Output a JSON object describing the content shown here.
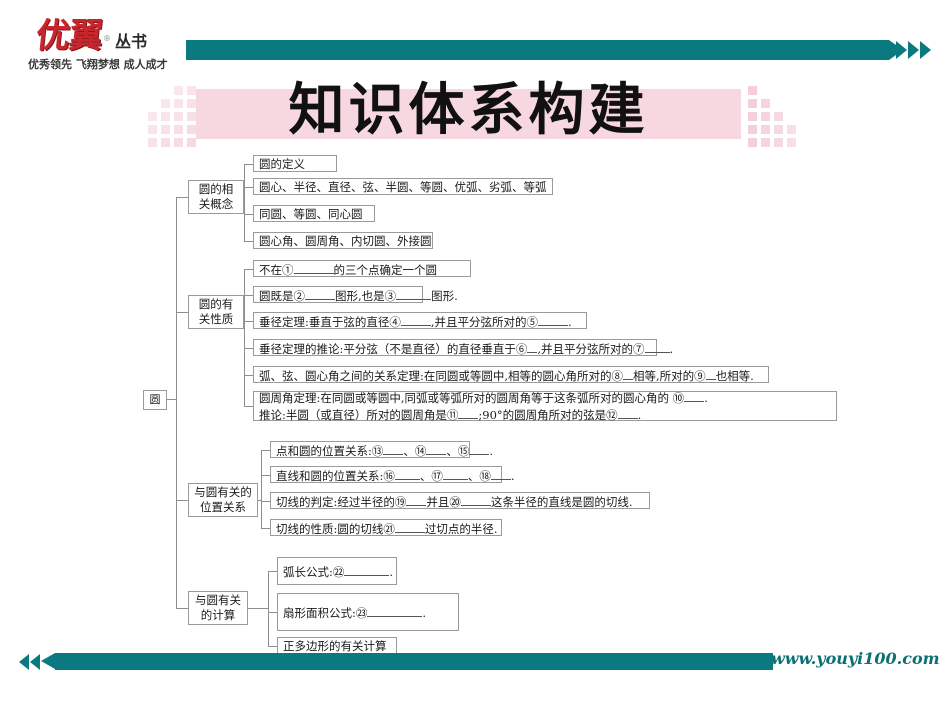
{
  "brand": {
    "logo_main": "优翼",
    "logo_reg": "®",
    "logo_series": "丛书",
    "slogan": "优秀领先 飞翔梦想 成人成才",
    "accent_teal": "#0b7a80",
    "accent_red": "#c9252c",
    "title_band_pink": "#f7d8e0"
  },
  "title": "知识体系构建",
  "footer": {
    "url": "www.youyi100.com"
  },
  "map": {
    "root": "圆",
    "branches": [
      {
        "label": "圆的相\n关概念",
        "label_lines": [
          "圆的相",
          "关概念"
        ],
        "items": [
          {
            "text": "圆的定义"
          },
          {
            "text": "圆心、半径、直径、弦、半圆、等圆、优弧、劣弧、等弧"
          },
          {
            "text": "同圆、等圆、同心圆"
          },
          {
            "text": "圆心角、圆周角、内切圆、外接圆"
          }
        ]
      },
      {
        "label_lines": [
          "圆的有",
          "关性质"
        ],
        "items": [
          {
            "text": "不在①________的三个点确定一个圆"
          },
          {
            "text": "圆既是②______图形,也是③_______图形."
          },
          {
            "text": "垂径定理:垂直于弦的直径④______,并且平分弦所对的⑤______."
          },
          {
            "text": "垂径定理的推论:平分弦（不是直径）的直径垂直于⑥__,并且平分弦所对的⑦_____."
          },
          {
            "text": "弧、弦、圆心角之间的关系定理:在同圆或等圆中,相等的圆心角所对的⑧__相等,所对的⑨__也相等."
          },
          {
            "lines": [
              "圆周角定理:在同圆或等圆中,同弧或等弧所对的圆周角等于这条弧所对的圆心角的 ⑩____.",
              "推论:半圆（或直径）所对的圆周角是⑪____;90°的圆周角所对的弦是⑫____."
            ]
          }
        ]
      },
      {
        "label_lines": [
          "与圆有关的",
          "位置关系"
        ],
        "items": [
          {
            "text": "点和圆的位置关系:⑬____、⑭____、⑮____."
          },
          {
            "text": "直线和圆的位置关系:⑯_____、⑰_____、⑱____."
          },
          {
            "text": "切线的判定:经过半径的⑲____并且⑳______这条半径的直线是圆的切线."
          },
          {
            "text": "切线的性质:圆的切线㉑______过切点的半径."
          }
        ]
      },
      {
        "label_lines": [
          "与圆有关",
          "的计算"
        ],
        "items": [
          {
            "text": "弧长公式:㉒_________."
          },
          {
            "text": "扇形面积公式:㉓___________."
          },
          {
            "text": "正多边形的有关计算"
          }
        ]
      }
    ]
  }
}
